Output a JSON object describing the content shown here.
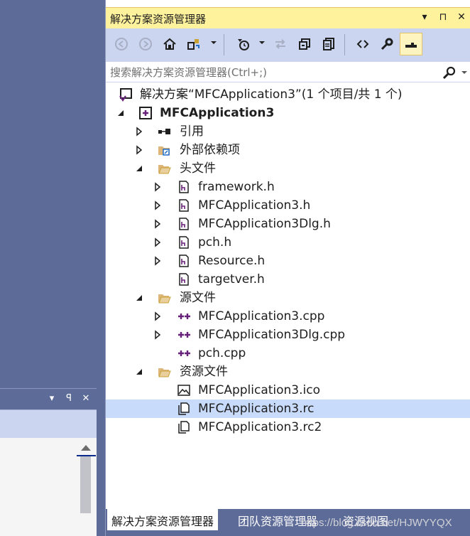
{
  "panel": {
    "title": "解决方案资源管理器",
    "search_placeholder": "搜索解决方案资源管理器(Ctrl+;)"
  },
  "title_tools": [
    "▾",
    "⊓",
    "✕"
  ],
  "tree": {
    "solution": "解决方案“MFCApplication3”(1 个项目/共 1 个)",
    "project": "MFCApplication3",
    "references": "引用",
    "external_deps": "外部依赖项",
    "header_folder": "头文件",
    "headers": [
      "framework.h",
      "MFCApplication3.h",
      "MFCApplication3Dlg.h",
      "pch.h",
      "Resource.h",
      "targetver.h"
    ],
    "source_folder": "源文件",
    "sources": [
      "MFCApplication3.cpp",
      "MFCApplication3Dlg.cpp",
      "pch.cpp"
    ],
    "resource_folder": "资源文件",
    "resources": [
      "MFCApplication3.ico",
      "MFCApplication3.rc",
      "MFCApplication3.rc2"
    ],
    "selected": "MFCApplication3.rc"
  },
  "tabs": [
    "解决方案资源管理器",
    "团队资源管理器",
    "资源视图"
  ],
  "watermark": "https://blog.csdn.net/HJWYYQX",
  "colors": {
    "titlebar_active": "#fff29d",
    "toolbar_bg": "#ccd5f0",
    "selection": "#c9dbfa",
    "frame_bg": "#5d6b99",
    "cpp_icon": "#68217a"
  }
}
